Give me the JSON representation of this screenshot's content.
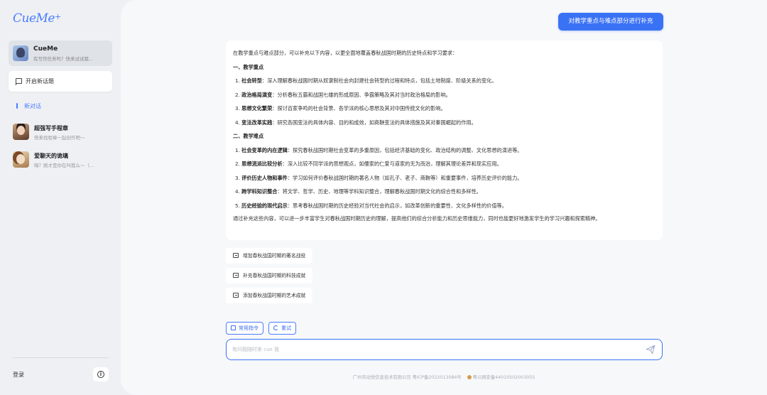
{
  "sidebar": {
    "logo": "CueMe",
    "logo_plus": "+",
    "bot": {
      "name": "CueMe",
      "subtitle": "有写作任务吗？快来试试我..."
    },
    "new_topic": "开启新话题",
    "active_chat": "新对话",
    "chats": [
      {
        "name": "超强写手程章",
        "subtitle": "快来找程章一起创作吧～"
      },
      {
        "name": "爱聊天的诡璃",
        "subtitle": "嗨？刚才是你在叫我么～（..."
      }
    ],
    "login": "登录",
    "info_icon": "i"
  },
  "conversation": {
    "user_message": "对教学重点与难点部分进行补充",
    "reply": {
      "intro": "在教学重点与难点部分，可以补充以下内容，以更全面地覆盖春秋战国时期的历史特点和学习要求：",
      "section1_title": "一、教学重点",
      "section1_items": [
        {
          "num": "1.",
          "term": "社会转型",
          "text": "：深入理解春秋战国时期从奴隶制社会向封建社会转型的过程和特点，包括土地制度、阶级关系的变化。"
        },
        {
          "num": "2.",
          "term": "政治格局演变",
          "text": "：分析春秋五霸和战国七雄的形成原因、争霸策略及其对当时政治格局的影响。"
        },
        {
          "num": "3.",
          "term": "思想文化繁荣",
          "text": "：探讨百家争鸣的社会背景、各学派的核心思想及其对中国传统文化的影响。"
        },
        {
          "num": "4.",
          "term": "变法改革实践",
          "text": "：研究各国变法的具体内容、目的和成效，如商鞅变法的具体措施及其对秦国崛起的作用。"
        }
      ],
      "section2_title": "二、教学难点",
      "section2_items": [
        {
          "num": "1.",
          "term": "社会变革的内在逻辑",
          "text": "：探究春秋战国时期社会变革的多重原因，包括经济基础的变化、政治结构的调整、文化思想的演进等。"
        },
        {
          "num": "2.",
          "term": "思想流派比较分析",
          "text": "：深入比较不同学派的思想观点，如儒家的仁爱与道家的无为而治，理解其理论差异和现实应用。"
        },
        {
          "num": "3.",
          "term": "评价历史人物和事件",
          "text": "：学习如何评价春秋战国时期的著名人物（如孔子、老子、商鞅等）和重要事件，培养历史评价的能力。"
        },
        {
          "num": "4.",
          "term": "跨学科知识整合",
          "text": "：将文学、哲学、历史、地理等学科知识整合，理解春秋战国时期文化的综合性和多样性。"
        },
        {
          "num": "5.",
          "term": "历史经验的现代启示",
          "text": "：思考春秋战国时期的历史经验对当代社会的启示，如改革创新的重要性、文化多样性的价值等。"
        }
      ],
      "conclusion": "通过补充这些内容，可以进一步丰富学生对春秋战国时期历史的理解，提高他们的综合分析能力和历史思维能力，同时也能更好地激发学生的学习兴趣和探索精神。"
    },
    "suggestions": [
      "增加春秋战国时期的著名战役",
      "补充春秋战国时期的科技成就",
      "添加春秋战国时期的艺术成就"
    ]
  },
  "composer": {
    "common_commands": "常用指令",
    "retry": "重试",
    "placeholder": "有问题随时来 cue 我"
  },
  "footer": {
    "company": "广州市动悦信息技术有限公司",
    "icp": "粤ICP备2022013084号",
    "police": "粤公网安备44010502003055"
  },
  "colors": {
    "accent": "#3a72f5"
  }
}
